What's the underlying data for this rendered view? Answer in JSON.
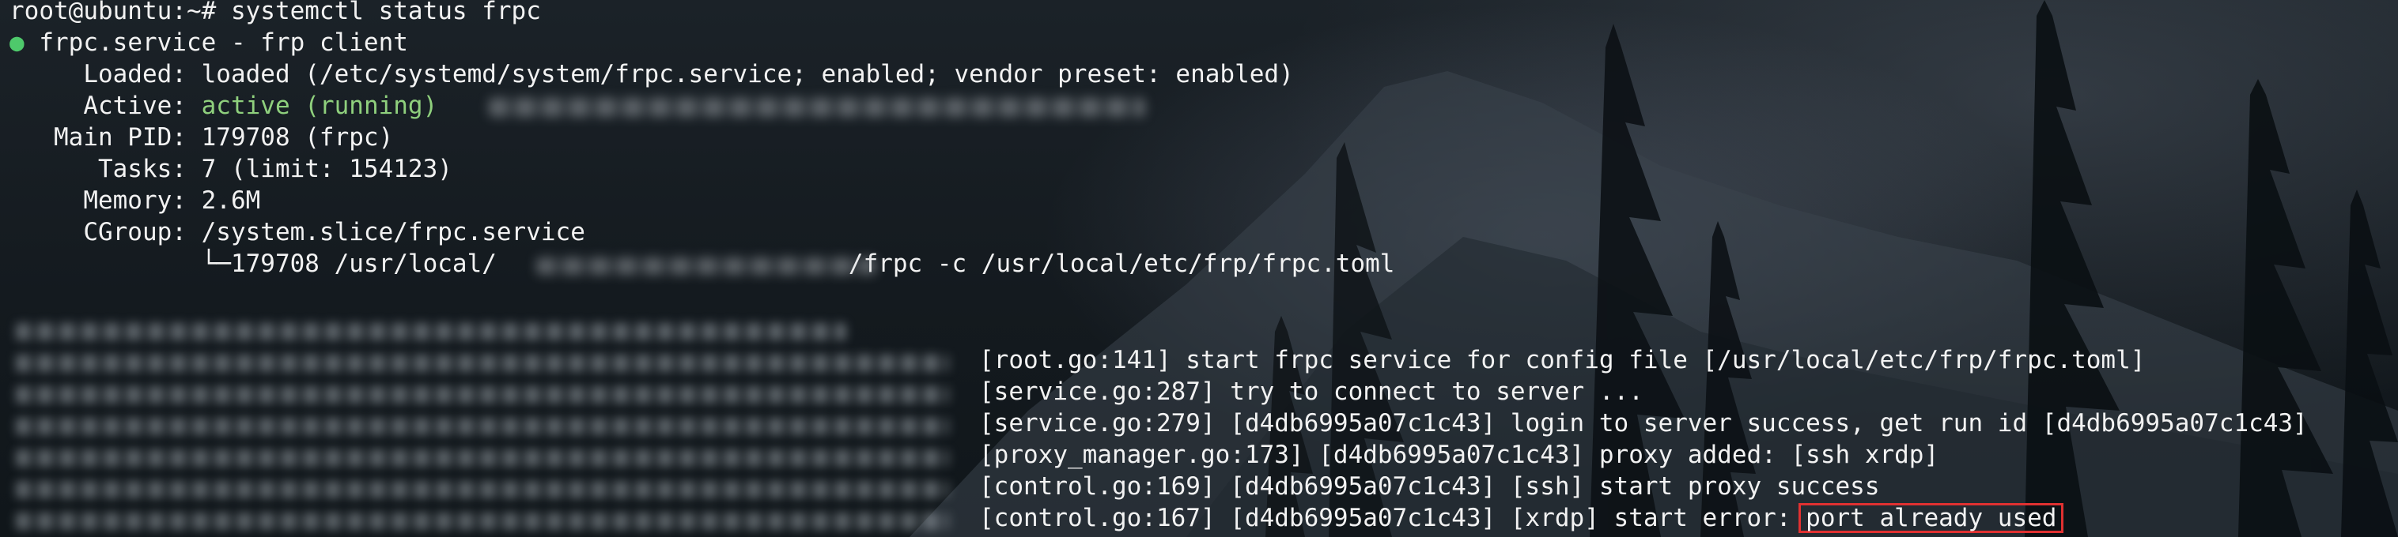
{
  "terminal": {
    "prompt_line": "root@ubuntu:~# systemctl status frpc",
    "status_dot": "●",
    "service_header": " frpc.service - frp client",
    "loaded_line": "     Loaded: loaded (/etc/systemd/system/frpc.service; enabled; vendor preset: enabled)",
    "active_label": "     Active: ",
    "active_value": "active (running)",
    "main_pid_line": "   Main PID: 179708 (frpc)",
    "tasks_line": "      Tasks: 7 (limit: 154123)",
    "memory_line": "     Memory: 2.6M",
    "cgroup_line": "     CGroup: /system.slice/frpc.service",
    "cgroup_child_prefix": "             └─179708 /usr/local/",
    "cgroup_child_suffix": "/frpc -c /usr/local/etc/frp/frpc.toml"
  },
  "logs": [
    {
      "text": "[root.go:141] start frpc service for config file [/usr/local/etc/frp/frpc.toml]"
    },
    {
      "text": "[service.go:287] try to connect to server ..."
    },
    {
      "text": "[service.go:279] [d4db6995a07c1c43] login to server success, get run id [d4db6995a07c1c43]"
    },
    {
      "text": "[proxy_manager.go:173] [d4db6995a07c1c43] proxy added: [ssh xrdp]"
    },
    {
      "text": "[control.go:169] [d4db6995a07c1c43] [ssh] start proxy success"
    },
    {
      "prefix": "[control.go:167] [d4db6995a07c1c43] [xrdp] start error: ",
      "highlight": "port already used"
    }
  ],
  "colors": {
    "text": "#f2f2f2",
    "active": "#8fd07d",
    "status_dot": "#4ec96b",
    "highlight_border": "#e03131"
  }
}
